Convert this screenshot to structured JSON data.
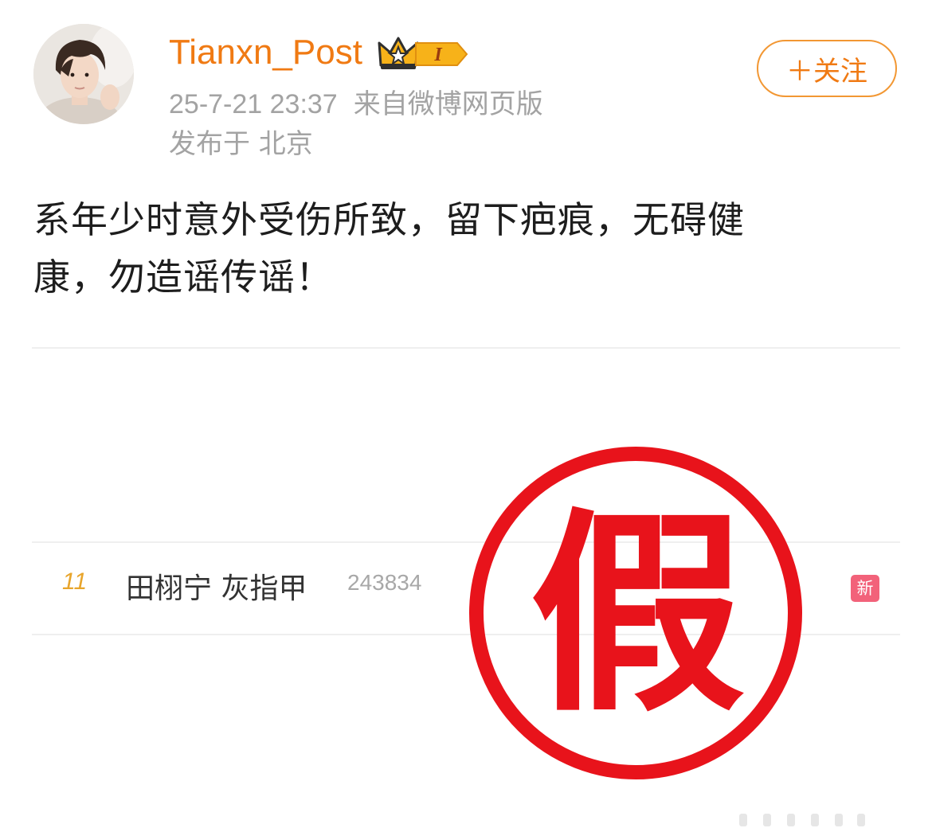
{
  "post": {
    "author": {
      "name": "Tianxn_Post",
      "vip_level": "I",
      "avatar_icon": "avatar-photo-icon",
      "crown_icon": "crown-icon"
    },
    "timestamp": "25-7-21 23:37",
    "source": "来自微博网页版",
    "location": "发布于 北京",
    "follow_label": "＋关注",
    "text_line1": "系年少时意外受伤所致，留下疤痕，无碍健",
    "text_line2": "康，勿造谣传谣！"
  },
  "image": {
    "hot_search": {
      "rank": "11",
      "topic": "田栩宁 灰指甲",
      "heat": "243834",
      "badge": "新"
    },
    "stamp_character": "假"
  },
  "colors": {
    "accent_orange": "#f07a13",
    "stamp_red": "#e8131b",
    "badge_pink": "#f2627a",
    "rank_gold": "#e8a52c"
  }
}
